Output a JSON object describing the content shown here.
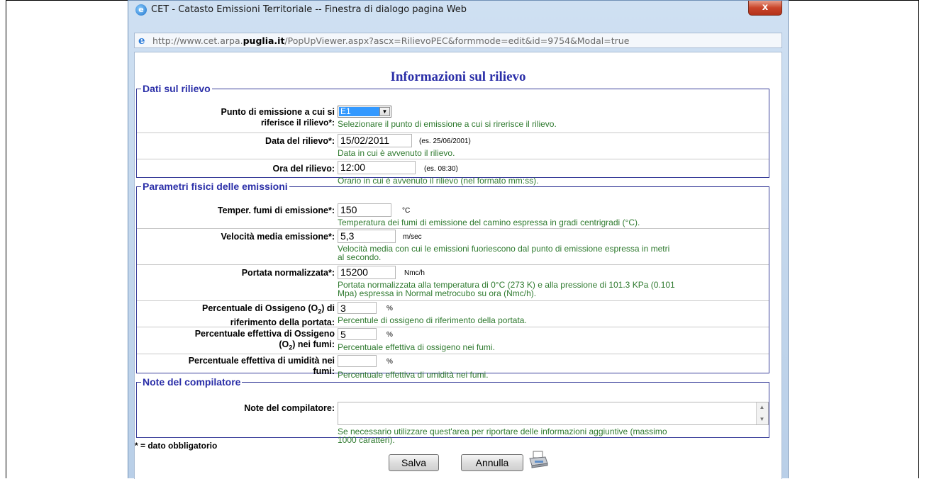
{
  "window": {
    "title": "CET - Catasto Emissioni Territoriale -- Finestra di dialogo pagina Web",
    "close_label": "x",
    "url_prefix": "http://www.cet.arpa.",
    "url_domain": "puglia.it",
    "url_suffix": "/PopUpViewer.aspx?ascx=RilievoPEC&formmode=edit&id=9754&Modal=true"
  },
  "form": {
    "title": "Informazioni sul rilievo",
    "required_note": "* = dato obbligatorio",
    "save_label": "Salva",
    "cancel_label": "Annulla"
  },
  "sections": {
    "dati": {
      "legend": "Dati sul rilievo",
      "punto_label_1": "Punto di emissione a cui si",
      "punto_label_2": "riferisce il rilievo*:",
      "punto_value": "E1",
      "punto_hint": "Selezionare il punto di emissione a cui si rirerisce il rilievo.",
      "data_label": "Data del rilievo*:",
      "data_value": "15/02/2011",
      "data_example": "(es. 25/06/2001)",
      "data_hint": "Data in cui è avvenuto il rilievo.",
      "ora_label": "Ora del rilievo:",
      "ora_value": "12:00",
      "ora_example": "(es. 08:30)",
      "ora_hint": "Orario in cui è avvenuto il rilievo (nel formato mm:ss)."
    },
    "parametri": {
      "legend": "Parametri fisici delle emissioni",
      "temp_label": "Temper. fumi di emissione*:",
      "temp_value": "150",
      "temp_unit": "°C",
      "temp_hint": "Temperatura dei fumi di emissione del camino espressa in gradi centrigradi (°C).",
      "vel_label": "Velocità media emissione*:",
      "vel_value": "5,3",
      "vel_unit": "m/sec",
      "vel_hint_1": "Velocità media con cui le emissioni fuoriescono dal punto di emissione espressa in metri",
      "vel_hint_2": "al secondo.",
      "port_label": "Portata normalizzata*:",
      "port_value": "15200",
      "port_unit": "Nmc/h",
      "port_hint_1": "Portata normalizzata alla temperatura di 0°C (273 K) e alla pressione di 101.3 KPa (0.101",
      "port_hint_2": "Mpa) espressa in Normal metrocubo su ora (Nmc/h).",
      "perc_rif_label_1": "Percentuale di Ossigeno (O",
      "perc_rif_label_sub": "2",
      "perc_rif_label_1b": ") di",
      "perc_rif_label_2": "riferimento della portata:",
      "perc_rif_value": "3",
      "perc_rif_unit": "%",
      "perc_rif_hint": "Percentule di ossigeno di riferimento della portata.",
      "perc_eff_label_1": "Percentuale effettiva di Ossigeno",
      "perc_eff_label_2a": "(O",
      "perc_eff_label_sub": "2",
      "perc_eff_label_2b": ") nei fumi:",
      "perc_eff_value": "5",
      "perc_eff_unit": "%",
      "perc_eff_hint": "Percentuale effettiva di ossigeno nei fumi.",
      "umid_label_1": "Percentuale effettiva di umidità nei",
      "umid_label_2": "fumi:",
      "umid_value": "",
      "umid_unit": "%",
      "umid_hint": "Percentuale effettiva di umidità nei fumi."
    },
    "note": {
      "legend": "Note del compilatore",
      "note_label": "Note del compilatore:",
      "note_value": "",
      "note_hint_1": "Se necessario utilizzare quest'area per riportare delle informazioni aggiuntive (massimo",
      "note_hint_2": "1000 caratteri)."
    }
  },
  "icons": {
    "ie": "internet-explorer-icon",
    "printer": "printer-icon"
  }
}
